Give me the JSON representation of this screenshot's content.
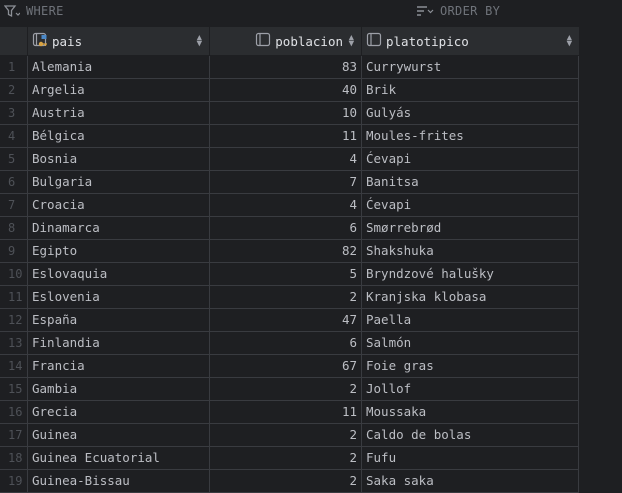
{
  "filter": {
    "where_label": "WHERE",
    "orderby_label": "ORDER BY"
  },
  "columns": [
    {
      "name": "pais",
      "icon": "key-column-icon"
    },
    {
      "name": "poblacion",
      "icon": "column-icon"
    },
    {
      "name": "platotipico",
      "icon": "column-icon"
    }
  ],
  "rows": [
    {
      "n": "1",
      "pais": "Alemania",
      "poblacion": "83",
      "plato": "Currywurst"
    },
    {
      "n": "2",
      "pais": "Argelia",
      "poblacion": "40",
      "plato": "Brik"
    },
    {
      "n": "3",
      "pais": "Austria",
      "poblacion": "10",
      "plato": "Gulyás"
    },
    {
      "n": "4",
      "pais": "Bélgica",
      "poblacion": "11",
      "plato": "Moules-frites"
    },
    {
      "n": "5",
      "pais": "Bosnia",
      "poblacion": "4",
      "plato": "Ćevapi"
    },
    {
      "n": "6",
      "pais": "Bulgaria",
      "poblacion": "7",
      "plato": "Banitsa"
    },
    {
      "n": "7",
      "pais": "Croacia",
      "poblacion": "4",
      "plato": "Ćevapi"
    },
    {
      "n": "8",
      "pais": "Dinamarca",
      "poblacion": "6",
      "plato": "Smørrebrød"
    },
    {
      "n": "9",
      "pais": "Egipto",
      "poblacion": "82",
      "plato": "Shakshuka"
    },
    {
      "n": "10",
      "pais": "Eslovaquia",
      "poblacion": "5",
      "plato": "Bryndzové halušky"
    },
    {
      "n": "11",
      "pais": "Eslovenia",
      "poblacion": "2",
      "plato": "Kranjska klobasa"
    },
    {
      "n": "12",
      "pais": "España",
      "poblacion": "47",
      "plato": "Paella"
    },
    {
      "n": "13",
      "pais": "Finlandia",
      "poblacion": "6",
      "plato": "Salmón"
    },
    {
      "n": "14",
      "pais": "Francia",
      "poblacion": "67",
      "plato": "Foie gras"
    },
    {
      "n": "15",
      "pais": "Gambia",
      "poblacion": "2",
      "plato": "Jollof"
    },
    {
      "n": "16",
      "pais": "Grecia",
      "poblacion": "11",
      "plato": "Moussaka"
    },
    {
      "n": "17",
      "pais": "Guinea",
      "poblacion": "2",
      "plato": "Caldo de bolas"
    },
    {
      "n": "18",
      "pais": "Guinea Ecuatorial",
      "poblacion": "2",
      "plato": "Fufu"
    },
    {
      "n": "19",
      "pais": "Guinea-Bissau",
      "poblacion": "2",
      "plato": "Saka saka"
    }
  ]
}
